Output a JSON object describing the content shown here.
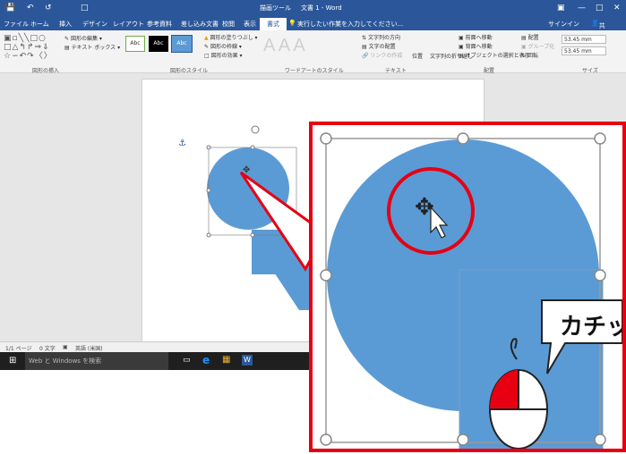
{
  "titlebar": {
    "context_tab": "描画ツール",
    "title": "文書 1 - Word",
    "signin": "サインイン",
    "share": "共有"
  },
  "tabs": [
    "ファイル",
    "ホーム",
    "挿入",
    "デザイン",
    "レイアウト",
    "参考資料",
    "差し込み文書",
    "校閲",
    "表示"
  ],
  "active_tab": "書式",
  "tell_me": "実行したい作業を入力してください...",
  "ribbon": {
    "edit_shape": "図形の編集",
    "text_box": "テキスト ボックス",
    "style_sample": "Abc",
    "fill": "図形の塗りつぶし",
    "outline": "図形の枠線",
    "effects": "図形の効果",
    "wordart_letter": "A",
    "text_direction": "文字列の方向",
    "align_text": "文字の配置",
    "create_link": "リンクの作成",
    "position": "位置",
    "wrap_text": "文字列の折り返し",
    "bring_forward": "前面へ移動",
    "send_backward": "背面へ移動",
    "selection_pane": "オブジェクトの選択と表示",
    "align": "配置",
    "group": "グループ化",
    "rotate": "回転",
    "height": "53.45 mm",
    "width": "53.45 mm",
    "groups": [
      "図形の挿入",
      "図形のスタイル",
      "ワードアートのスタイル",
      "テキスト",
      "配置",
      "サイズ"
    ]
  },
  "statusbar": {
    "page": "1/1 ページ",
    "words": "0 文字",
    "language": "英語 (米国)"
  },
  "taskbar": {
    "search_placeholder": "Web と Windows を検索"
  },
  "callout": {
    "text": "カチッ"
  },
  "colors": {
    "title_blue": "#2b579a",
    "shape_blue": "#5b9bd5",
    "highlight_red": "#e60012"
  }
}
